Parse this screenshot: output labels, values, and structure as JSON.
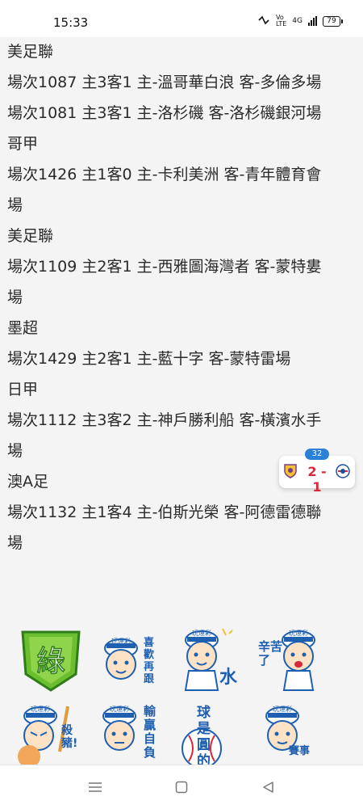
{
  "status_bar": {
    "time": "15:33",
    "battery": "79",
    "network_label": "4G"
  },
  "lines": [
    "美足聯",
    "場次1087 主3客1 主-溫哥華白浪 客-多倫多場",
    "場次1081 主3客1 主-洛杉磯 客-洛杉磯銀河場",
    "哥甲",
    "場次1426 主1客0 主-卡利美洲 客-青年體育會",
    "場",
    "美足聯",
    "場次1109 主2客1 主-西雅圖海灣者 客-蒙特婁",
    "場",
    "墨超",
    "場次1429 主2客1 主-藍十字 客-蒙特雷場",
    "日甲",
    "場次1112 主3客2 主-神戶勝利船 客-橫濱水手",
    "場",
    "澳A足",
    "場次1132 主1客4 主-伯斯光榮 客-阿德雷德聯",
    "場"
  ],
  "score_widget": {
    "minute": "32",
    "score": "2 - 1"
  },
  "stickers": [
    {
      "name": "green-sticker",
      "text": "綠",
      "brand": ""
    },
    {
      "name": "like-again-sticker",
      "text": "喜歡再跟",
      "brand": "玩運彩"
    },
    {
      "name": "water-sticker",
      "text": "水",
      "brand": "玩運彩"
    },
    {
      "name": "thanks-sticker",
      "text": "辛苦了",
      "brand": "玩運彩"
    },
    {
      "name": "kill-pig-sticker",
      "text": "殺豬!",
      "brand": "玩運彩"
    },
    {
      "name": "win-lose-sticker",
      "text": "輸贏自負",
      "brand": "玩運彩"
    },
    {
      "name": "ball-round-sticker",
      "text": "球是圓的",
      "brand": ""
    },
    {
      "name": "match-sticker",
      "text": "賽事",
      "brand": "玩運彩"
    }
  ],
  "colors": {
    "accent_blue": "#2a7fd6",
    "score_red": "#d8283a",
    "sticker_green": "#6bbf2f"
  }
}
